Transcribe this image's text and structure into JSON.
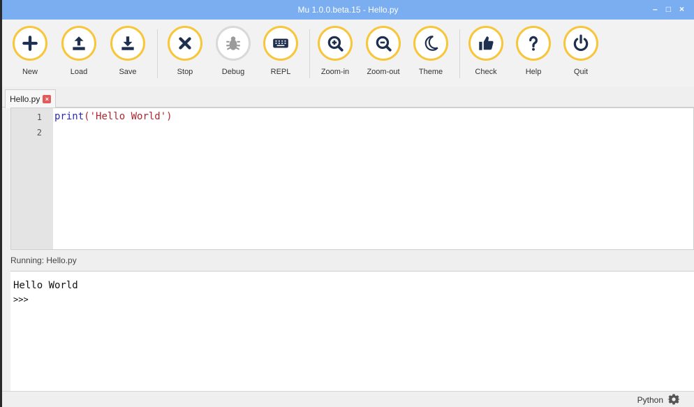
{
  "window": {
    "title": "Mu 1.0.0.beta.15 - Hello.py",
    "minimize": "–",
    "maximize": "□",
    "close": "×"
  },
  "toolbar": {
    "buttons": [
      {
        "label": "New",
        "icon": "plus-icon"
      },
      {
        "label": "Load",
        "icon": "upload-icon"
      },
      {
        "label": "Save",
        "icon": "download-icon"
      },
      {
        "label": "Stop",
        "icon": "x-icon"
      },
      {
        "label": "Debug",
        "icon": "bug-icon"
      },
      {
        "label": "REPL",
        "icon": "keyboard-icon"
      },
      {
        "label": "Zoom-in",
        "icon": "zoom-in-icon"
      },
      {
        "label": "Zoom-out",
        "icon": "zoom-out-icon"
      },
      {
        "label": "Theme",
        "icon": "moon-icon"
      },
      {
        "label": "Check",
        "icon": "thumbs-up-icon"
      },
      {
        "label": "Help",
        "icon": "question-icon"
      },
      {
        "label": "Quit",
        "icon": "power-icon"
      }
    ]
  },
  "tabs": [
    {
      "label": "Hello.py"
    }
  ],
  "editor": {
    "line_numbers": [
      "1",
      "2"
    ],
    "code_keyword": "print",
    "code_rest": "('Hello World')"
  },
  "runner": {
    "status": "Running: Hello.py"
  },
  "repl": {
    "output": "Hello World",
    "prompt": ">>>"
  },
  "statusbar": {
    "mode": "Python"
  },
  "colors": {
    "accent": "#f7c63b",
    "titlebar": "#7aaef0",
    "icon": "#1f2f4f"
  }
}
